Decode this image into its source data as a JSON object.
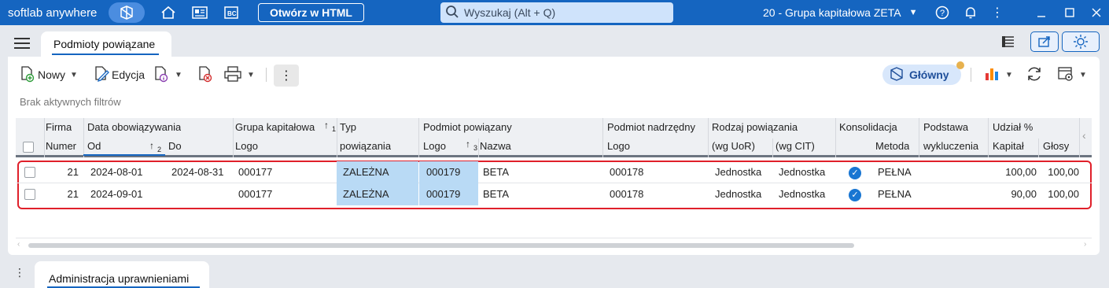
{
  "app": {
    "brand": "softlab anywhere",
    "open_html_label": "Otwórz w HTML",
    "search_placeholder": "Wyszukaj (Alt + Q)",
    "company": "20 - Grupa kapitałowa ZETA",
    "accent": "#1565c0"
  },
  "tabs": {
    "main": "Podmioty powiązane",
    "bottom": "Administracja uprawnieniami"
  },
  "toolbar": {
    "new_label": "Nowy",
    "edit_label": "Edycja",
    "glowny_label": "Główny",
    "filters_text": "Brak aktywnych filtrów"
  },
  "columns": {
    "firma": "Firma",
    "numer": "Numer",
    "data_obow": "Data obowiązywania",
    "od": "Od",
    "do": "Do",
    "od_sort": "2",
    "grupa": "Grupa kapitałowa",
    "grupa_sort": "1",
    "grupa_logo": "Logo",
    "typ": "Typ",
    "typ2": "powiązania",
    "podmiot": "Podmiot powiązany",
    "podmiot_logo": "Logo",
    "podmiot_nazwa": "Nazwa",
    "nazwa_sort": "3",
    "nadrzedny": "Podmiot nadrzędny",
    "nadrzedny_logo": "Logo",
    "rodzaj": "Rodzaj powiązania",
    "rodzaj_uor": "(wg UoR)",
    "rodzaj_cit": "(wg CIT)",
    "kons": "Konsolidacja",
    "metoda": "Metoda",
    "podstawa": "Podstawa",
    "wykluczenia": "wykluczenia",
    "udzial": "Udział %",
    "kapital": "Kapitał",
    "glosy": "Głosy"
  },
  "rows": [
    {
      "numer": "21",
      "od": "2024-08-01",
      "do": "2024-08-31",
      "grupa": "000177",
      "typ": "ZALEŻNA",
      "pod_logo": "000179",
      "nazwa": "BETA",
      "nadrz": "000178",
      "uor": "Jednostka",
      "cit": "Jednostka",
      "metoda": "PEŁNA",
      "kapital": "100,00",
      "glosy": "100,00"
    },
    {
      "numer": "21",
      "od": "2024-09-01",
      "do": "",
      "grupa": "000177",
      "typ": "ZALEŻNA",
      "pod_logo": "000179",
      "nazwa": "BETA",
      "nadrz": "000178",
      "uor": "Jednostka",
      "cit": "Jednostka",
      "metoda": "PEŁNA",
      "kapital": "90,00",
      "glosy": "100,00"
    }
  ]
}
